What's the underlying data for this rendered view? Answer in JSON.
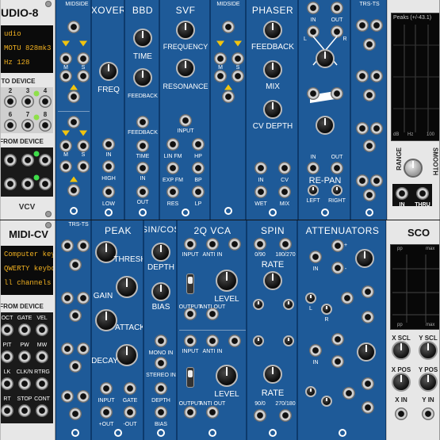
{
  "rack": {
    "background": "#222222"
  },
  "audio8": {
    "title": "UDIO-8",
    "screen_lines": [
      "udio",
      "MOTU 828mk3 Hyb",
      "Hz   128"
    ],
    "to_device": "TO DEVICE",
    "from_device": "FROM DEVICE",
    "to_nums": [
      "1",
      "2",
      "3",
      "4",
      "5",
      "6",
      "7",
      "8"
    ],
    "from_nums": [
      "1",
      "2",
      "3",
      "4",
      "5",
      "6",
      "7",
      "8"
    ],
    "brand": "VCV"
  },
  "midsideA": {
    "title": "MIDSIDE",
    "labels": [
      "M",
      "S",
      "M",
      "S",
      "M",
      "S",
      "M",
      "S"
    ]
  },
  "xover": {
    "title": "XOVER",
    "freq": "FREQ",
    "in": "IN",
    "high": "HIGH",
    "low": "LOW"
  },
  "bbd": {
    "title": "BBD",
    "time": "TIME",
    "feedback": "FEEDBACK",
    "fb_cv": "FEEDBACK",
    "time_cv": "TIME",
    "in": "IN",
    "out": "OUT"
  },
  "svf": {
    "title": "SVF",
    "frequency": "FREQUENCY",
    "resonance": "RESONANCE",
    "input": "INPUT",
    "lin_fm": "LIN FM",
    "hp": "HP",
    "exp_fm": "EXP FM",
    "bp": "BP",
    "res": "RES",
    "lp": "LP"
  },
  "midsideB": {
    "title": "MIDSIDE",
    "labels": [
      "M",
      "S",
      "M",
      "S"
    ]
  },
  "phaser": {
    "title": "PHASER",
    "feedback": "FEEDBACK",
    "mix": "MIX",
    "cv_depth": "CV DEPTH",
    "in": "IN",
    "cv": "CV",
    "wet": "WET",
    "mix_out": "MIX"
  },
  "repan": {
    "in": "IN",
    "out": "OUT",
    "l": "L",
    "r": "R",
    "title": "RE-PAN",
    "left": "LEFT",
    "right": "RIGHT",
    "in2": "IN",
    "out2": "OUT"
  },
  "trs1": {
    "title": "TRS-TS"
  },
  "scope1": {
    "readout": "Peaks (+/-43.1)",
    "hz": "Hz",
    "hz_val": "100",
    "db": "dB",
    "range": "RANGE",
    "smooth": "SMOOTH",
    "in": "IN",
    "thru": "THRU"
  },
  "midicv": {
    "title": "MIDI-CV",
    "screen_lines": [
      "Computer keyboard",
      "QWERTY keyboard",
      "ll channels"
    ],
    "from_device": "FROM DEVICE",
    "labels": [
      "OCT",
      "GATE",
      "VEL",
      "PIT",
      "PW",
      "MW",
      "LK",
      "CLK/N",
      "RTRG",
      "RT",
      "STOP",
      "CONT"
    ]
  },
  "trs2": {
    "title": "TRS-TS"
  },
  "peak": {
    "title": "PEAK",
    "thresh": "THRESH",
    "gain": "GAIN",
    "attack": "ATTACK",
    "decay": "DECAY",
    "input": "INPUT",
    "gate": "GATE",
    "pos_out": "+OUT",
    "neg_out": "-OUT"
  },
  "sincos": {
    "title": "SIN/COS",
    "depth": "DEPTH",
    "bias": "BIAS",
    "mono_in": "MONO IN",
    "stereo_in": "STEREO IN",
    "depth_cv": "DEPTH",
    "bias_cv": "BIAS"
  },
  "vca": {
    "title": "2Q VCA",
    "input": "INPUT",
    "anti_in": "ANTI IN",
    "level": "LEVEL",
    "output": "OUTPUT",
    "anti_out": "ANTI OUT",
    "input2": "INPUT",
    "anti_in2": "ANTI IN",
    "level2": "LEVEL",
    "output2": "OUTPUT",
    "anti_out2": "ANTI OUT"
  },
  "spin": {
    "title": "SPIN",
    "p0": "0/90",
    "p1": "180/270",
    "rate": "RATE",
    "rate2": "RATE",
    "p2": "90/0",
    "p3": "270/180"
  },
  "atten": {
    "title": "ATTENUATORS",
    "in": "IN",
    "l": "L",
    "r": "R",
    "plus": "+",
    "minus": "-"
  },
  "scope2": {
    "title": "SCO",
    "top_pp": "pp",
    "top_max": "max",
    "bot_pp": "pp",
    "bot_max": "max",
    "xscl": "X SCL",
    "yscl": "Y SCL",
    "xpos": "X POS",
    "ypos": "Y POS",
    "xin": "X IN",
    "yin": "Y IN"
  }
}
